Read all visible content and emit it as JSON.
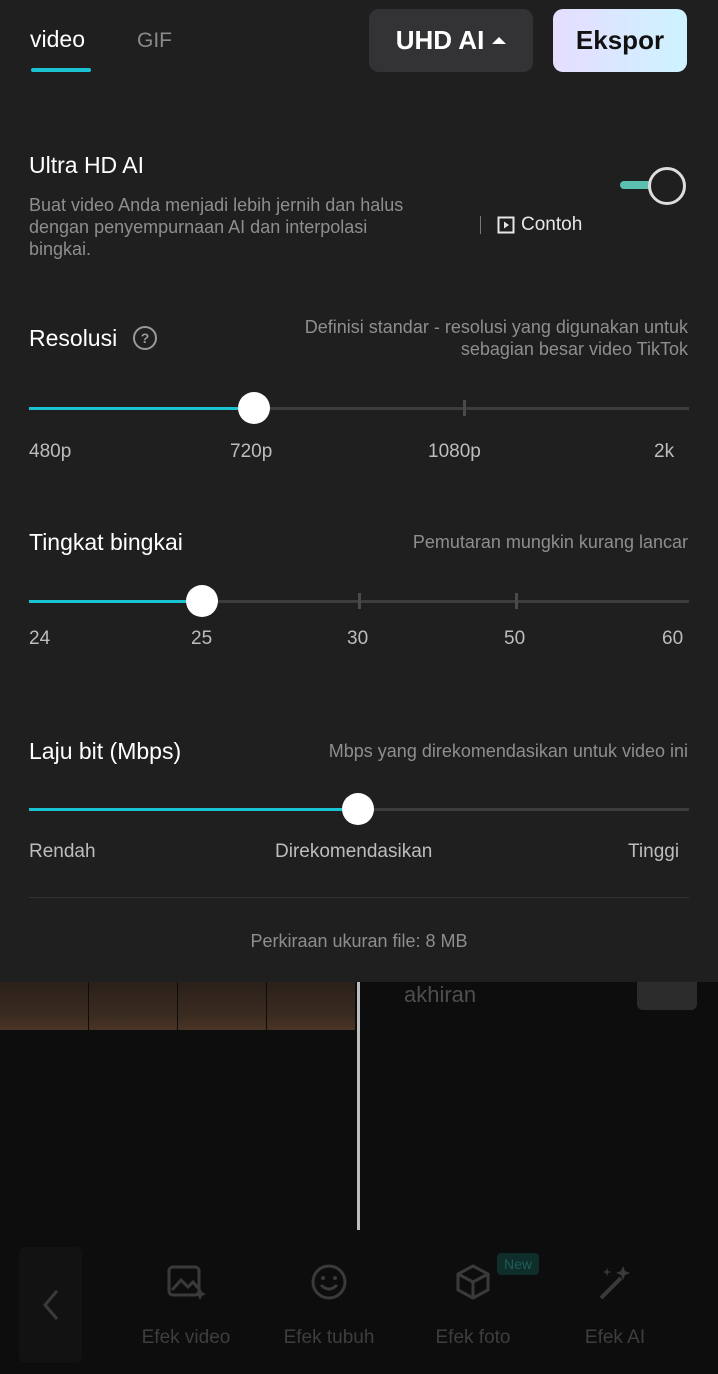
{
  "tabs": [
    {
      "label": "video"
    },
    {
      "label": "GIF"
    }
  ],
  "header": {
    "quality_label": "UHD AI",
    "export_label": "Ekspor"
  },
  "ultra_hd": {
    "title": "Ultra HD AI",
    "description": [
      "Buat video Anda menjadi lebih jernih dan halus",
      "dengan penyempurnaan AI dan interpolasi",
      "bingkai."
    ],
    "example_label": "Contoh",
    "enabled": true
  },
  "resolution": {
    "title": "Resolusi",
    "hint": [
      "Definisi standar - resolusi yang digunakan untuk",
      "sebagian besar video TikTok"
    ],
    "options": [
      "480p",
      "720p",
      "1080p",
      "2k"
    ],
    "selected_index": 1
  },
  "frame_rate": {
    "title": "Tingkat bingkai",
    "hint": "Pemutaran mungkin kurang lancar",
    "options": [
      "24",
      "25",
      "30",
      "50",
      "60"
    ],
    "selected_index": 1
  },
  "bitrate": {
    "title": "Laju bit (Mbps)",
    "hint": "Mbps yang direkomendasikan untuk video ini",
    "options": [
      "Rendah",
      "Direkomendasikan",
      "Tinggi"
    ],
    "selected_index": 1
  },
  "file_size_label": "Perkiraan ukuran file: 8 MB",
  "timeline": {
    "ending_label": "akhiran"
  },
  "toolbar": {
    "items": [
      {
        "label": "Efek video",
        "icon": "image-effect-icon"
      },
      {
        "label": "Efek tubuh",
        "icon": "face-icon"
      },
      {
        "label": "Efek foto",
        "icon": "cube-icon"
      },
      {
        "label": "Efek AI",
        "icon": "magic-wand-icon"
      }
    ],
    "new_badge": "New"
  },
  "colors": {
    "accent": "#19c3d1",
    "toggle": "#5bc0b0",
    "panel": "#1f1f1f"
  }
}
